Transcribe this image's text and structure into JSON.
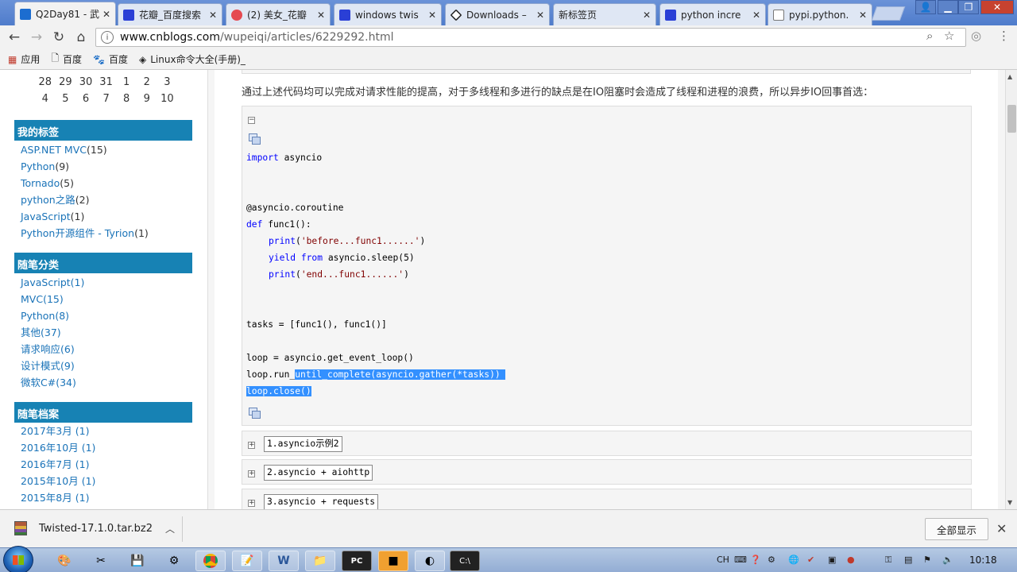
{
  "browser": {
    "tabs": [
      {
        "title": "Q2Day81 - 武",
        "favicon": "cnblogs-icon",
        "color": "#1c6dd0",
        "active": true
      },
      {
        "title": "花瓣_百度搜索",
        "favicon": "baidu-paw-icon",
        "color": "#2a3fd6"
      },
      {
        "title": "(2) 美女_花瓣",
        "favicon": "huaban-icon",
        "color": "#e54950"
      },
      {
        "title": "windows twis",
        "favicon": "baidu-paw-icon",
        "color": "#2a3fd6"
      },
      {
        "title": "Downloads –",
        "favicon": "diamond-icon",
        "color": "#222222"
      },
      {
        "title": "新标签页",
        "favicon": "",
        "color": ""
      },
      {
        "title": "python incre",
        "favicon": "baidu-paw-icon",
        "color": "#2a3fd6"
      },
      {
        "title": "pypi.python.",
        "favicon": "page-icon",
        "color": "#777777"
      }
    ],
    "url_host": "www.cnblogs.com",
    "url_path": "/wupeiqi/articles/6229292.html",
    "bookmarks": [
      {
        "label": "应用",
        "icon": "apps-grid-icon"
      },
      {
        "label": "百度",
        "icon": "page-icon"
      },
      {
        "label": "百度",
        "icon": "baidu-paw-icon"
      },
      {
        "label": "Linux命令大全(手册)_",
        "icon": "diamond-icon"
      }
    ]
  },
  "sidebar": {
    "calendar_rows": [
      [
        "28",
        "29",
        "30",
        "31",
        "1",
        "2",
        "3"
      ],
      [
        "4",
        "5",
        "6",
        "7",
        "8",
        "9",
        "10"
      ]
    ],
    "sections": [
      {
        "title": "我的标签",
        "items": [
          {
            "label": "ASP.NET MVC",
            "count": "(15)"
          },
          {
            "label": "Python",
            "count": "(9)"
          },
          {
            "label": "Tornado",
            "count": "(5)"
          },
          {
            "label": "python之路",
            "count": "(2)"
          },
          {
            "label": "JavaScript",
            "count": "(1)"
          },
          {
            "label": "Python开源组件 - Tyrion",
            "count": "(1)"
          }
        ]
      },
      {
        "title": "随笔分类",
        "items": [
          {
            "label": "JavaScript(1)",
            "count": ""
          },
          {
            "label": "MVC(15)",
            "count": ""
          },
          {
            "label": "Python(8)",
            "count": ""
          },
          {
            "label": "其他(37)",
            "count": ""
          },
          {
            "label": "请求响应(6)",
            "count": ""
          },
          {
            "label": "设计模式(9)",
            "count": ""
          },
          {
            "label": "微软C#(34)",
            "count": ""
          }
        ]
      },
      {
        "title": "随笔档案",
        "items": [
          {
            "label": "2017年3月 (1)",
            "count": ""
          },
          {
            "label": "2016年10月 (1)",
            "count": ""
          },
          {
            "label": "2016年7月 (1)",
            "count": ""
          },
          {
            "label": "2015年10月 (1)",
            "count": ""
          },
          {
            "label": "2015年8月 (1)",
            "count": ""
          }
        ]
      }
    ]
  },
  "article": {
    "paragraph": "通过上述代码均可以完成对请求性能的提高，对于多线程和多进行的缺点是在IO阻塞时会造成了线程和进程的浪费，所以异步IO回事首选：",
    "code": {
      "l1_kw": "import",
      "l1_rest": " asyncio",
      "l2": "@asyncio.coroutine",
      "l3_kw": "def",
      "l3_rest": " func1():",
      "l4_kw": "print",
      "l4_rest": "(",
      "l4_str": "'before...func1......'",
      "l4_end": ")",
      "l5_kw1": "yield",
      "l5_mid": " ",
      "l5_kw2": "from",
      "l5_rest": " asyncio.sleep(5)",
      "l6_kw": "print",
      "l6_rest": "(",
      "l6_str": "'end...func1......'",
      "l6_end": ")",
      "l7": "tasks = [func1(), func1()]",
      "l8": "loop = asyncio.get_event_loop()",
      "l9_a": "loop.run_",
      "l9_sel": "until_complete(asyncio.gather(*tasks))",
      "l10_sel": "loop.close()"
    },
    "folds": [
      "1.asyncio示例2",
      "2.asyncio + aiohttp",
      "3.asyncio + requests"
    ]
  },
  "downloads": {
    "file": "Twisted-17.1.0.tar.bz2",
    "show_all": "全部显示"
  },
  "taskbar": {
    "ime": "CH",
    "clock": "10:18"
  }
}
